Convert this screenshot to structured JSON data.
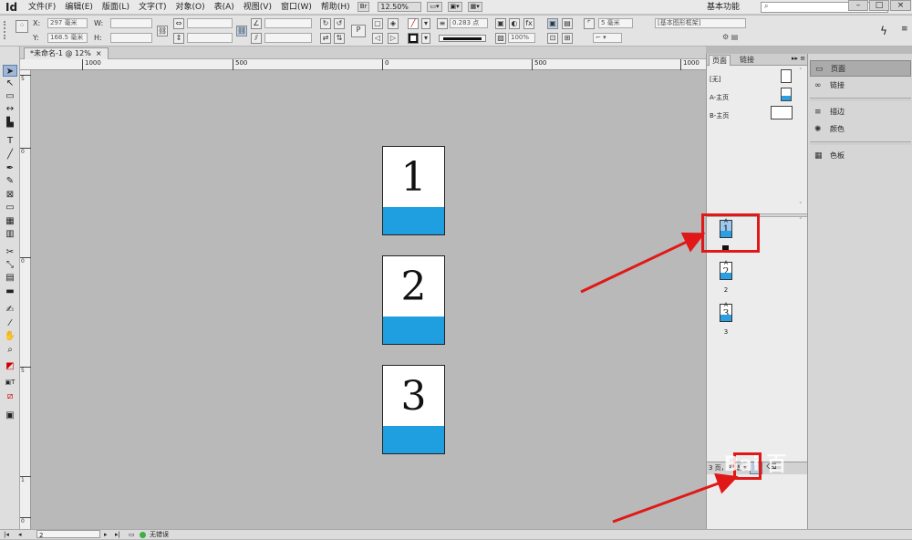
{
  "app": {
    "logo": "Id"
  },
  "menubar": {
    "items": [
      "文件(F)",
      "编辑(E)",
      "版面(L)",
      "文字(T)",
      "对象(O)",
      "表(A)",
      "视图(V)",
      "窗口(W)",
      "帮助(H)"
    ],
    "br_badge": "Br",
    "zoom": "12.50%",
    "workspace": "基本功能",
    "minimize": "–",
    "maximize": "□",
    "close": "×"
  },
  "controlbar": {
    "x_label": "X:",
    "x_value": "297 毫米",
    "y_label": "Y:",
    "y_value": "168.5 毫米",
    "w_label": "W:",
    "h_label": "H:",
    "stroke_weight": "0.283 点",
    "scale_percent": "100%",
    "gap_value": "5 毫米",
    "frame_style": "[基本图形框架]"
  },
  "document": {
    "tab_title": "*未命名-1 @ 12%",
    "tab_close": "×"
  },
  "ruler": {
    "h_ticks": [
      "1000",
      "500",
      "0",
      "500",
      "1000"
    ],
    "v_ticks": [
      "5",
      "0",
      "0",
      "5",
      "1",
      "0"
    ]
  },
  "pages_on_canvas": [
    {
      "number": "1"
    },
    {
      "number": "2"
    },
    {
      "number": "3"
    }
  ],
  "pages_panel": {
    "tab_pages": "页面",
    "tab_links": "链接",
    "menu": "▸▸ ≡",
    "masters": [
      {
        "name": "[无]"
      },
      {
        "name": "A-主页"
      },
      {
        "name": "B-主页"
      }
    ],
    "page_thumbs": [
      {
        "letter": "A",
        "number": "1",
        "label": "1"
      },
      {
        "letter": "A",
        "number": "2",
        "label": "2"
      },
      {
        "letter": "A",
        "number": "3",
        "label": "3"
      }
    ],
    "bottom_text": "3 页，3 跨页"
  },
  "dock": {
    "items": [
      {
        "label": "页面",
        "icon": "pages-icon"
      },
      {
        "label": "链接",
        "icon": "links-icon"
      },
      {
        "label": "描边",
        "icon": "stroke-icon"
      },
      {
        "label": "颜色",
        "icon": "color-icon"
      },
      {
        "label": "色板",
        "icon": "swatches-icon"
      }
    ]
  },
  "statusbar": {
    "page_field": "2",
    "preflight": "无错误"
  },
  "watermark": "Bai 百",
  "colors": {
    "accent_blue": "#1f9ee0",
    "annotation_red": "#e01818",
    "pasteboard": "#b9b9b9"
  }
}
